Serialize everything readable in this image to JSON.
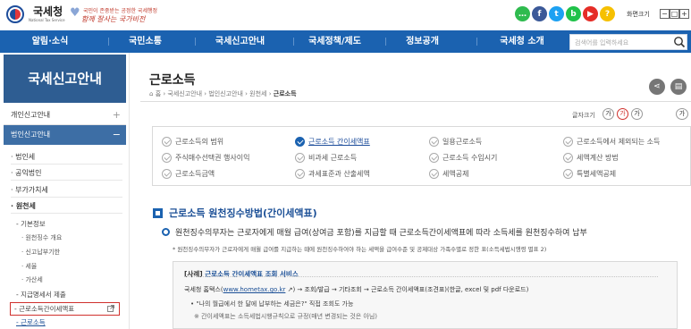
{
  "header": {
    "logo_text": "국세청",
    "logo_sub": "National Tax Service",
    "slogan_line1": "국민이 존중받는 공정한 국세행정",
    "slogan_line2": "함께 잘사는 국가비전",
    "zoom_label": "화면크기",
    "zoom_minus": "−",
    "zoom_reset": "□",
    "zoom_plus": "+",
    "sns": [
      {
        "name": "chat-icon",
        "glyph": "…",
        "color": "#2fbb4f"
      },
      {
        "name": "facebook-icon",
        "glyph": "f",
        "color": "#3b5998"
      },
      {
        "name": "twitter-icon",
        "glyph": "t",
        "color": "#1da1f2"
      },
      {
        "name": "blog-icon",
        "glyph": "b",
        "color": "#20c24a"
      },
      {
        "name": "youtube-icon",
        "glyph": "▶",
        "color": "#e52d27"
      },
      {
        "name": "kakaostory-icon",
        "glyph": "?",
        "color": "#f6c000"
      }
    ]
  },
  "nav": {
    "items": [
      "알림·소식",
      "국민소통",
      "국세신고안내",
      "국세정책/제도",
      "정보공개",
      "국세청 소개"
    ],
    "search_placeholder": "검색어를 입력하세요"
  },
  "sidebar": {
    "title": "국세신고안내",
    "sections": [
      {
        "label": "개인신고안내",
        "toggle": "+"
      },
      {
        "label": "법인신고안내",
        "toggle": "−"
      }
    ],
    "items": [
      "· 법인세",
      "· 공익법인",
      "· 부가가치세",
      "· 원천세"
    ],
    "sub_items": [
      "- 기본정보",
      "- 지급명세서 제출",
      "- 근로소득간이세액표",
      "- 근로소득"
    ],
    "deep_items": [
      "· 원천징수 개요",
      "· 신고납부기한",
      "· 세율",
      "· 가산세"
    ]
  },
  "main": {
    "title": "근로소득",
    "breadcrumb": [
      "홈",
      "국세신고안내",
      "법인신고안내",
      "원천세",
      "근로소득"
    ],
    "share_label": "share-icon",
    "print_label": "print-icon",
    "font_size_label": "글자크기",
    "font_buttons": [
      "가",
      "가",
      "가",
      "가"
    ],
    "tabs": [
      {
        "label": "근로소득의 범위",
        "active": false
      },
      {
        "label": "근로소득 간이세액표",
        "active": true
      },
      {
        "label": "일용근로소득",
        "active": false
      },
      {
        "label": "근로소득에서 제외되는 소득",
        "active": false
      },
      {
        "label": "주식매수선택권 행사이익",
        "active": false
      },
      {
        "label": "비과세 근로소득",
        "active": false
      },
      {
        "label": "근로소득 수입시기",
        "active": false
      },
      {
        "label": "세액계산 방법",
        "active": false
      },
      {
        "label": "근로소득금액",
        "active": false
      },
      {
        "label": "과세표준과 산출세액",
        "active": false
      },
      {
        "label": "세액공제",
        "active": false
      },
      {
        "label": "특별세액공제",
        "active": false
      }
    ],
    "section_heading": "근로소득 원천징수방법(간이세액표)",
    "description": "원천징수의무자는 근로자에게 매월 급여(상여금 포함)를 지급할 때 근로소득간이세액표에 따라 소득세를 원천징수하여 납부",
    "note": "* 원천징수의무자가 근로자에게 매월 급여를 지급하는 때에 원천징수하여야 하는 세액을 급여수준 및 공제대상 가족수별로 정한 표(소득세법시행령 별표 2)",
    "example": {
      "tag": "[사례]",
      "title": "근로소득 간이세액표 조회 서비스",
      "line1_prefix": "국세청 홈택스(",
      "line1_link": "www.hometax.go.kr",
      "line1_suffix": ") → 조회/발급 → 기타조회 → 근로소득 간이세액표(조견표)(한글, excel 및 pdf 다운로드)",
      "line2": "• \"나의 월급에서 한 달에 납부하는 세금은?\" 직접 조회도 가능",
      "line3": "※ 간이세액표는 소득세법시행규칙으로 규정(매년 변경되는 것은 아님)"
    }
  }
}
